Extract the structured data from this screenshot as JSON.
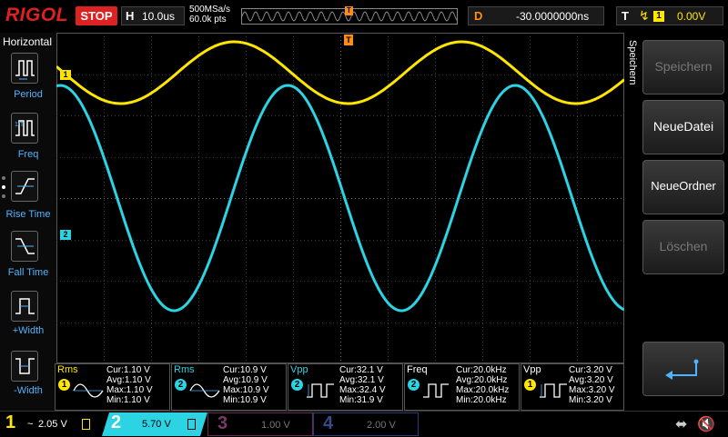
{
  "header": {
    "logo": "RIGOL",
    "run_state": "STOP",
    "horizontal_label": "H",
    "timebase": "10.0us",
    "sample_rate": "500MSa/s",
    "memory_depth": "60.0k pts",
    "delay_label": "D",
    "delay_value": "-30.0000000ns",
    "trigger_label": "T",
    "trigger_channel": "1",
    "trigger_level": "0.00V",
    "trigger_marker": "T"
  },
  "left_panel": {
    "title": "Horizontal",
    "items": [
      {
        "label": "Period"
      },
      {
        "label": "Freq"
      },
      {
        "label": "Rise Time"
      },
      {
        "label": "Fall Time"
      },
      {
        "label": "+Width"
      },
      {
        "label": "-Width"
      }
    ]
  },
  "channels_markers": {
    "ch1": "1",
    "ch2": "2"
  },
  "right_menu": {
    "title": "Speichern",
    "items": [
      {
        "label": "Speichern",
        "enabled": false
      },
      {
        "label": "NeueDatei",
        "enabled": true
      },
      {
        "label": "NeueOrdner",
        "enabled": true
      },
      {
        "label": "Löschen",
        "enabled": false
      }
    ]
  },
  "measurements": [
    {
      "name": "Rms",
      "channel": "1",
      "color": "#ffe600",
      "cur": "Cur:1.10 V",
      "avg": "Avg:1.10 V",
      "max": "Max:1.10 V",
      "min": "Min:1.10 V"
    },
    {
      "name": "Rms",
      "channel": "2",
      "color": "#2cd3e3",
      "cur": "Cur:10.9 V",
      "avg": "Avg:10.9 V",
      "max": "Max:10.9 V",
      "min": "Min:10.9 V"
    },
    {
      "name": "Vpp",
      "channel": "2",
      "color": "#2cd3e3",
      "cur": "Cur:32.1 V",
      "avg": "Avg:32.1 V",
      "max": "Max:32.4 V",
      "min": "Min:31.9 V"
    },
    {
      "name": "Freq",
      "channel": "2",
      "color": "#2cd3e3",
      "cur": "Cur:20.0kHz",
      "avg": "Avg:20.0kHz",
      "max": "Max:20.0kHz",
      "min": "Min:20.0kHz"
    },
    {
      "name": "Vpp",
      "channel": "1",
      "color": "#ffe600",
      "cur": "Cur:3.20 V",
      "avg": "Avg:3.20 V",
      "max": "Max:3.20 V",
      "min": "Min:3.20 V"
    }
  ],
  "bottom": {
    "ch1": {
      "num": "1",
      "scale": "2.05 V",
      "coupling": "~",
      "color": "#ffe600"
    },
    "ch2": {
      "num": "2",
      "scale": "5.70 V",
      "color": "#2cd3e3"
    },
    "ch3": {
      "num": "3",
      "scale": "1.00 V",
      "color": "#c03090"
    },
    "ch4": {
      "num": "4",
      "scale": "2.00 V",
      "color": "#3060d0"
    }
  },
  "colors": {
    "ch1": "#ffe600",
    "ch2": "#2cd3e3",
    "accent_blue": "#4fb3ff",
    "trigger_orange": "#ff8c1a",
    "stop_red": "#dd2222"
  }
}
